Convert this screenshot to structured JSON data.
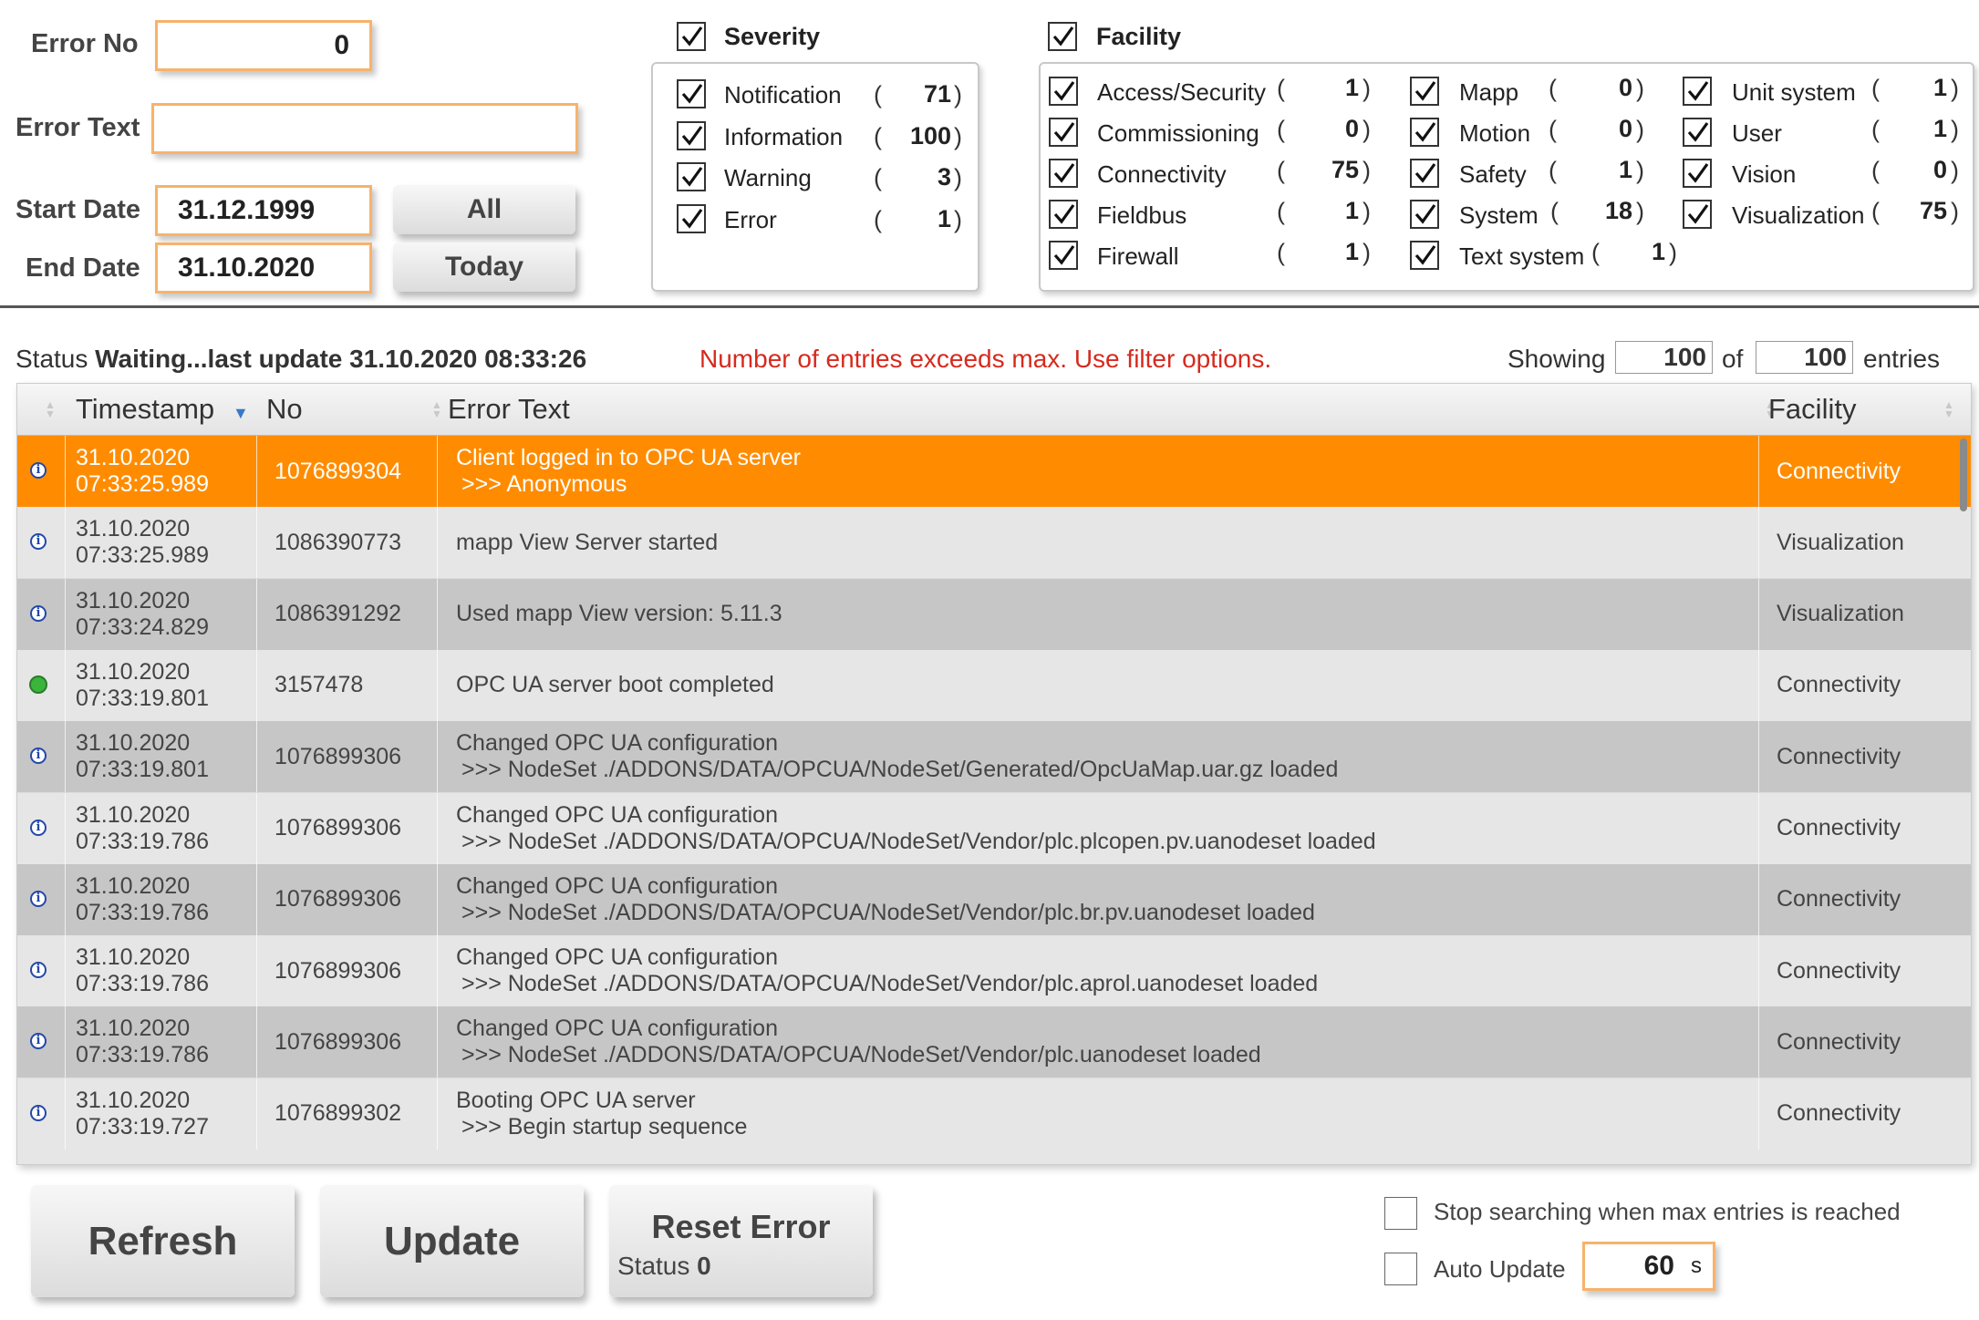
{
  "filters": {
    "error_no_label": "Error No",
    "error_no_value": "0",
    "error_text_label": "Error Text",
    "error_text_value": "",
    "start_date_label": "Start Date",
    "start_date_value": "31.12.1999",
    "end_date_label": "End Date",
    "end_date_value": "31.10.2020",
    "all_button": "All",
    "today_button": "Today"
  },
  "severity": {
    "title": "Severity",
    "checked": true,
    "items": [
      {
        "label": "Notification",
        "count": "71",
        "checked": true
      },
      {
        "label": "Information",
        "count": "100",
        "checked": true
      },
      {
        "label": "Warning",
        "count": "3",
        "checked": true
      },
      {
        "label": "Error",
        "count": "1",
        "checked": true
      }
    ]
  },
  "facility": {
    "title": "Facility",
    "checked": true,
    "items": [
      {
        "label": "Access/Security",
        "count": "1",
        "checked": true
      },
      {
        "label": "Commissioning",
        "count": "0",
        "checked": true
      },
      {
        "label": "Connectivity",
        "count": "75",
        "checked": true
      },
      {
        "label": "Fieldbus",
        "count": "1",
        "checked": true
      },
      {
        "label": "Firewall",
        "count": "1",
        "checked": true
      },
      {
        "label": "Mapp",
        "count": "0",
        "checked": true
      },
      {
        "label": "Motion",
        "count": "0",
        "checked": true
      },
      {
        "label": "Safety",
        "count": "1",
        "checked": true
      },
      {
        "label": "System",
        "count": "18",
        "checked": true
      },
      {
        "label": "Text system",
        "count": "1",
        "checked": true
      },
      {
        "label": "Unit system",
        "count": "1",
        "checked": true
      },
      {
        "label": "User",
        "count": "1",
        "checked": true
      },
      {
        "label": "Vision",
        "count": "0",
        "checked": true
      },
      {
        "label": "Visualization",
        "count": "75",
        "checked": true
      }
    ]
  },
  "status": {
    "label": "Status",
    "text": "Waiting...last update 31.10.2020 08:33:26",
    "warning": "Number of entries exceeds max. Use filter options.",
    "showing_label": "Showing",
    "showing_value": "100",
    "of_label": "of",
    "total_value": "100",
    "entries_label": "entries"
  },
  "table": {
    "columns": [
      "Timestamp",
      "No",
      "Error Text",
      "Facility"
    ],
    "rows": [
      {
        "date": "31.10.2020",
        "time": "07:33:25.989",
        "no": "1076899304",
        "text1": "Client logged in to OPC UA server",
        "text2": ">>> Anonymous",
        "facility": "Connectivity",
        "icon": "info-icon",
        "selected": true
      },
      {
        "date": "31.10.2020",
        "time": "07:33:25.989",
        "no": "1086390773",
        "text1": "mapp View Server started",
        "text2": "",
        "facility": "Visualization",
        "icon": "info-icon",
        "selected": false
      },
      {
        "date": "31.10.2020",
        "time": "07:33:24.829",
        "no": "1086391292",
        "text1": "Used mapp View version: 5.11.3",
        "text2": "",
        "facility": "Visualization",
        "icon": "info-icon",
        "selected": false
      },
      {
        "date": "31.10.2020",
        "time": "07:33:19.801",
        "no": "3157478",
        "text1": "OPC UA server boot completed",
        "text2": "",
        "facility": "Connectivity",
        "icon": "success-icon",
        "selected": false
      },
      {
        "date": "31.10.2020",
        "time": "07:33:19.801",
        "no": "1076899306",
        "text1": "Changed OPC UA configuration",
        "text2": ">>> NodeSet ./ADDONS/DATA/OPCUA/NodeSet/Generated/OpcUaMap.uar.gz loaded",
        "facility": "Connectivity",
        "icon": "info-icon",
        "selected": false
      },
      {
        "date": "31.10.2020",
        "time": "07:33:19.786",
        "no": "1076899306",
        "text1": "Changed OPC UA configuration",
        "text2": ">>> NodeSet ./ADDONS/DATA/OPCUA/NodeSet/Vendor/plc.plcopen.pv.uanodeset loaded",
        "facility": "Connectivity",
        "icon": "info-icon",
        "selected": false
      },
      {
        "date": "31.10.2020",
        "time": "07:33:19.786",
        "no": "1076899306",
        "text1": "Changed OPC UA configuration",
        "text2": ">>> NodeSet ./ADDONS/DATA/OPCUA/NodeSet/Vendor/plc.br.pv.uanodeset loaded",
        "facility": "Connectivity",
        "icon": "info-icon",
        "selected": false
      },
      {
        "date": "31.10.2020",
        "time": "07:33:19.786",
        "no": "1076899306",
        "text1": "Changed OPC UA configuration",
        "text2": ">>> NodeSet ./ADDONS/DATA/OPCUA/NodeSet/Vendor/plc.aprol.uanodeset loaded",
        "facility": "Connectivity",
        "icon": "info-icon",
        "selected": false
      },
      {
        "date": "31.10.2020",
        "time": "07:33:19.786",
        "no": "1076899306",
        "text1": "Changed OPC UA configuration",
        "text2": ">>> NodeSet ./ADDONS/DATA/OPCUA/NodeSet/Vendor/plc.uanodeset loaded",
        "facility": "Connectivity",
        "icon": "info-icon",
        "selected": false
      },
      {
        "date": "31.10.2020",
        "time": "07:33:19.727",
        "no": "1076899302",
        "text1": "Booting OPC UA server",
        "text2": ">>> Begin startup sequence",
        "facility": "Connectivity",
        "icon": "info-icon",
        "selected": false
      }
    ]
  },
  "footer": {
    "refresh_button": "Refresh",
    "update_button": "Update",
    "reset_error_button": "Reset Error",
    "reset_status_label": "Status",
    "reset_status_value": "0",
    "stop_searching_label": "Stop searching when max entries is reached",
    "stop_searching_checked": false,
    "auto_update_label": "Auto Update",
    "auto_update_checked": false,
    "auto_update_value": "60",
    "auto_update_unit": "s"
  }
}
